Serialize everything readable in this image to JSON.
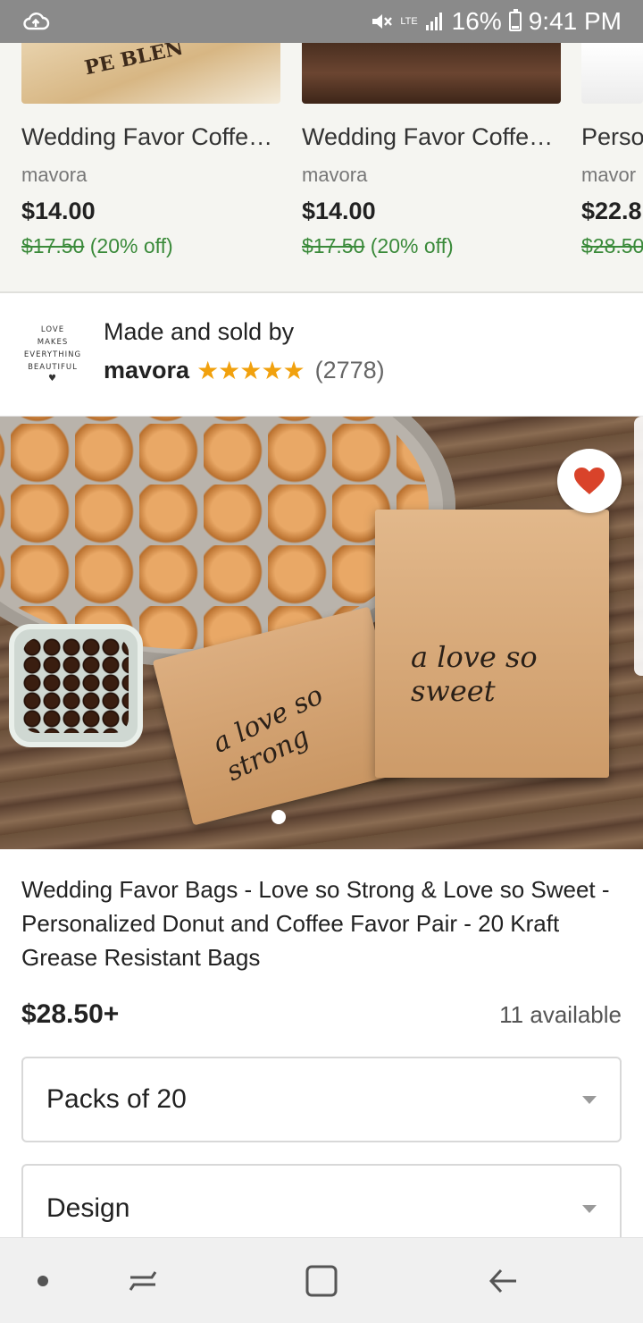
{
  "status_bar": {
    "lte_label": "LTE",
    "battery": "16%",
    "time": "9:41 PM",
    "icons": [
      "cloud-upload-icon",
      "mute-icon",
      "signal-icon",
      "battery-icon"
    ]
  },
  "related_items": [
    {
      "title": "Wedding Favor Coffee...",
      "shop": "mavora",
      "price": "$14.00",
      "original_price": "$17.50",
      "discount": "(20% off)",
      "thumb_text": "PE BLEN"
    },
    {
      "title": "Wedding Favor Coffee...",
      "shop": "mavora",
      "price": "$14.00",
      "original_price": "$17.50",
      "discount": "(20% off)"
    },
    {
      "title": "Perso",
      "shop": "mavor",
      "price": "$22.8",
      "original_price": "$28.50"
    }
  ],
  "seller": {
    "logo_lines": [
      "LOVE",
      "MAKES",
      "EVERYTHING",
      "BEAUTIFUL"
    ],
    "made_by_label": "Made and sold by",
    "shop_name": "mavora",
    "rating_stars": "★★★★★",
    "rating_value": 5,
    "review_count": "(2778)"
  },
  "hero": {
    "bag_left_script": "a love so strong",
    "bag_right_script": "a love so sweet",
    "favorite_icon": "heart-icon",
    "accent_color": "#d9432a"
  },
  "product": {
    "title": "Wedding Favor Bags - Love so Strong & Love so Sweet - Personalized Donut and Coffee Favor Pair - 20 Kraft Grease Resistant Bags",
    "price": "$28.50+",
    "availability": "11 available",
    "options": [
      {
        "value": "Packs of 20"
      },
      {
        "value": "Design"
      }
    ]
  },
  "nav": {
    "icons": [
      "nav-dot-icon",
      "recents-icon",
      "home-icon",
      "back-icon"
    ]
  }
}
